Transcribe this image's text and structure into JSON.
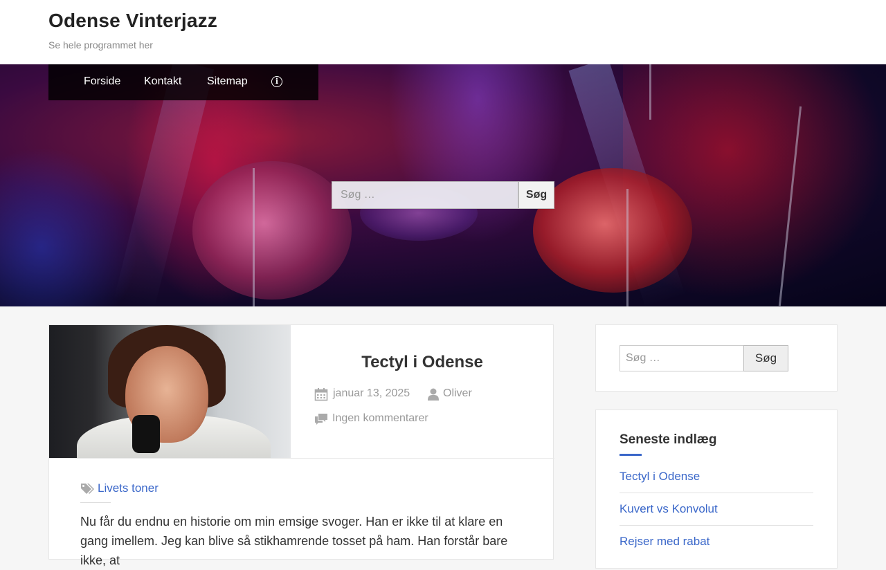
{
  "site": {
    "title": "Odense Vinterjazz",
    "description": "Se hele programmet her"
  },
  "nav": {
    "items": [
      "Forside",
      "Kontakt",
      "Sitemap"
    ],
    "info_icon": "info-circle-icon"
  },
  "hero_search": {
    "placeholder": "Søg …",
    "button_label": "Søg"
  },
  "post": {
    "title": "Tectyl i Odense",
    "date": "januar 13, 2025",
    "author": "Oliver",
    "comments": "Ingen kommentarer",
    "category": "Livets toner",
    "excerpt": "Nu får du endnu en historie om min emsige svoger. Han er ikke til at klare en gang imellem. Jeg kan blive så stikhamrende tosset på ham. Han forstår bare ikke, at"
  },
  "sidebar": {
    "search": {
      "placeholder": "Søg …",
      "button_label": "Søg"
    },
    "recent": {
      "title": "Seneste indlæg",
      "items": [
        "Tectyl i Odense",
        "Kuvert vs Konvolut",
        "Rejser med rabat"
      ]
    }
  },
  "colors": {
    "link": "#3a67c9",
    "accent": "#3a67c9"
  }
}
